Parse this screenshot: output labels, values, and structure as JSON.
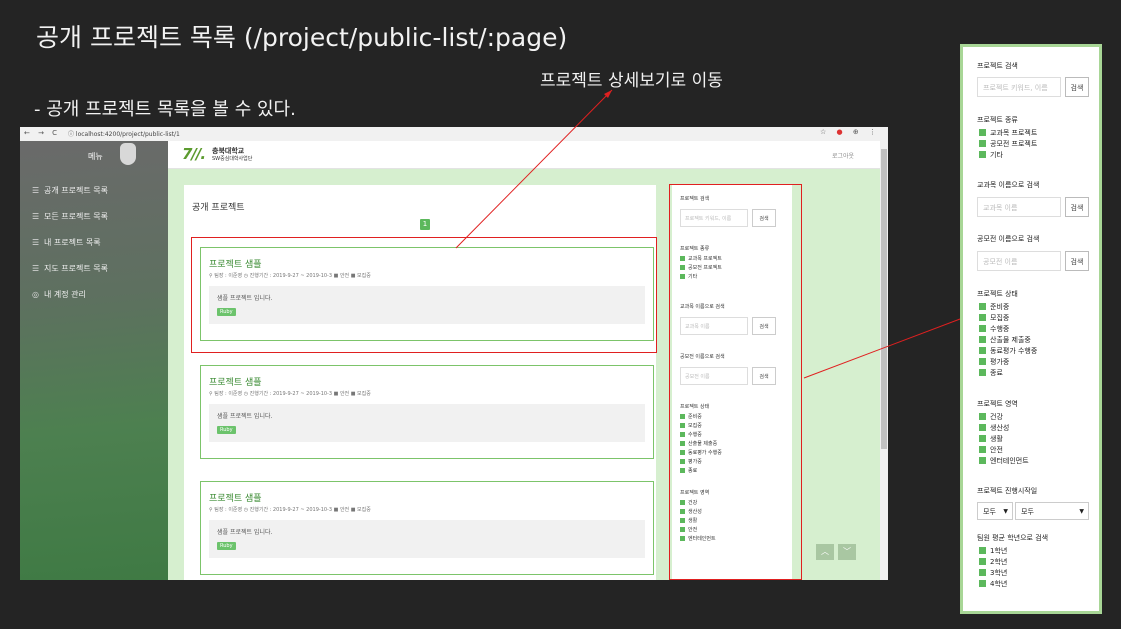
{
  "slide": {
    "title": "공개 프로젝트 목록 (/project/public-list/:page)",
    "description": "- 공개 프로젝트 목록을 볼 수 있다.",
    "callout": "프로젝트 상세보기로 이동"
  },
  "browser": {
    "nav": "← → C",
    "url": "ⓘ localhost:4200/project/public-list/1",
    "right_icons": [
      "☆",
      "●",
      "⊕",
      "⋮"
    ]
  },
  "sidebar": {
    "title": "메뉴",
    "items": [
      {
        "icon": "☰",
        "label": "공개 프로젝트 목록"
      },
      {
        "icon": "☰",
        "label": "모든 프로젝트 목록"
      },
      {
        "icon": "☰",
        "label": "내 프로젝트 목록"
      },
      {
        "icon": "☰",
        "label": "지도 프로젝트 목록"
      },
      {
        "icon": "◎",
        "label": "내 계정 관리"
      }
    ]
  },
  "topbar": {
    "logo": "7//.",
    "university": "충북대학교",
    "department": "SW중심대학사업단",
    "logout": "로그아웃"
  },
  "main": {
    "card_title": "공개 프로젝트",
    "page": "1",
    "projects": [
      {
        "name": "프로젝트 샘플",
        "meta": "⚲ 팀장 : 이준영 ◷ 진행기간 : 2019-9-27 ~ 2019-10-3 ■ 안전 ■ 모집중",
        "desc": "샘플 프로젝트 입니다.",
        "tag": "Ruby"
      },
      {
        "name": "프로젝트 샘플",
        "meta": "⚲ 팀장 : 이준영 ◷ 진행기간 : 2019-9-27 ~ 2019-10-3 ■ 안전 ■ 모집중",
        "desc": "샘플 프로젝트 입니다.",
        "tag": "Ruby"
      },
      {
        "name": "프로젝트 샘플",
        "meta": "⚲ 팀장 : 이준영 ◷ 진행기간 : 2019-9-27 ~ 2019-10-3 ■ 안전 ■ 모집중",
        "desc": "샘플 프로젝트 입니다.",
        "tag": "Ruby"
      }
    ]
  },
  "filter": {
    "search_label": "프로젝트 검색",
    "search_placeholder": "프로젝트 키워드, 이름",
    "search_button": "검색",
    "type_label": "프로젝트 종류",
    "types": [
      "교과목 프로젝트",
      "공모전 프로젝트",
      "기타"
    ],
    "course_label": "교과목 이름으로 검색",
    "course_placeholder": "교과목 이름",
    "contest_label": "공모전 이름으로 검색",
    "contest_placeholder": "공모전 이름",
    "status_label": "프로젝트 상태",
    "statuses": [
      "준비중",
      "모집중",
      "수행중",
      "산출물 제출중",
      "동료평가 수행중",
      "평가중",
      "종료"
    ],
    "area_label": "프로젝트 영역",
    "areas": [
      "건강",
      "생산성",
      "생활",
      "안전",
      "엔터테인먼트"
    ],
    "start_label": "프로젝트 진행시작일",
    "start_options": [
      "모두",
      "모두"
    ],
    "grade_label": "팀원 평균 학년으로 검색",
    "grades": [
      "1학년",
      "2학년",
      "3학년",
      "4학년"
    ]
  },
  "colors": {
    "accent_green": "#5cb85c",
    "highlight_red": "#e02020",
    "content_bg": "#d6efcf"
  }
}
